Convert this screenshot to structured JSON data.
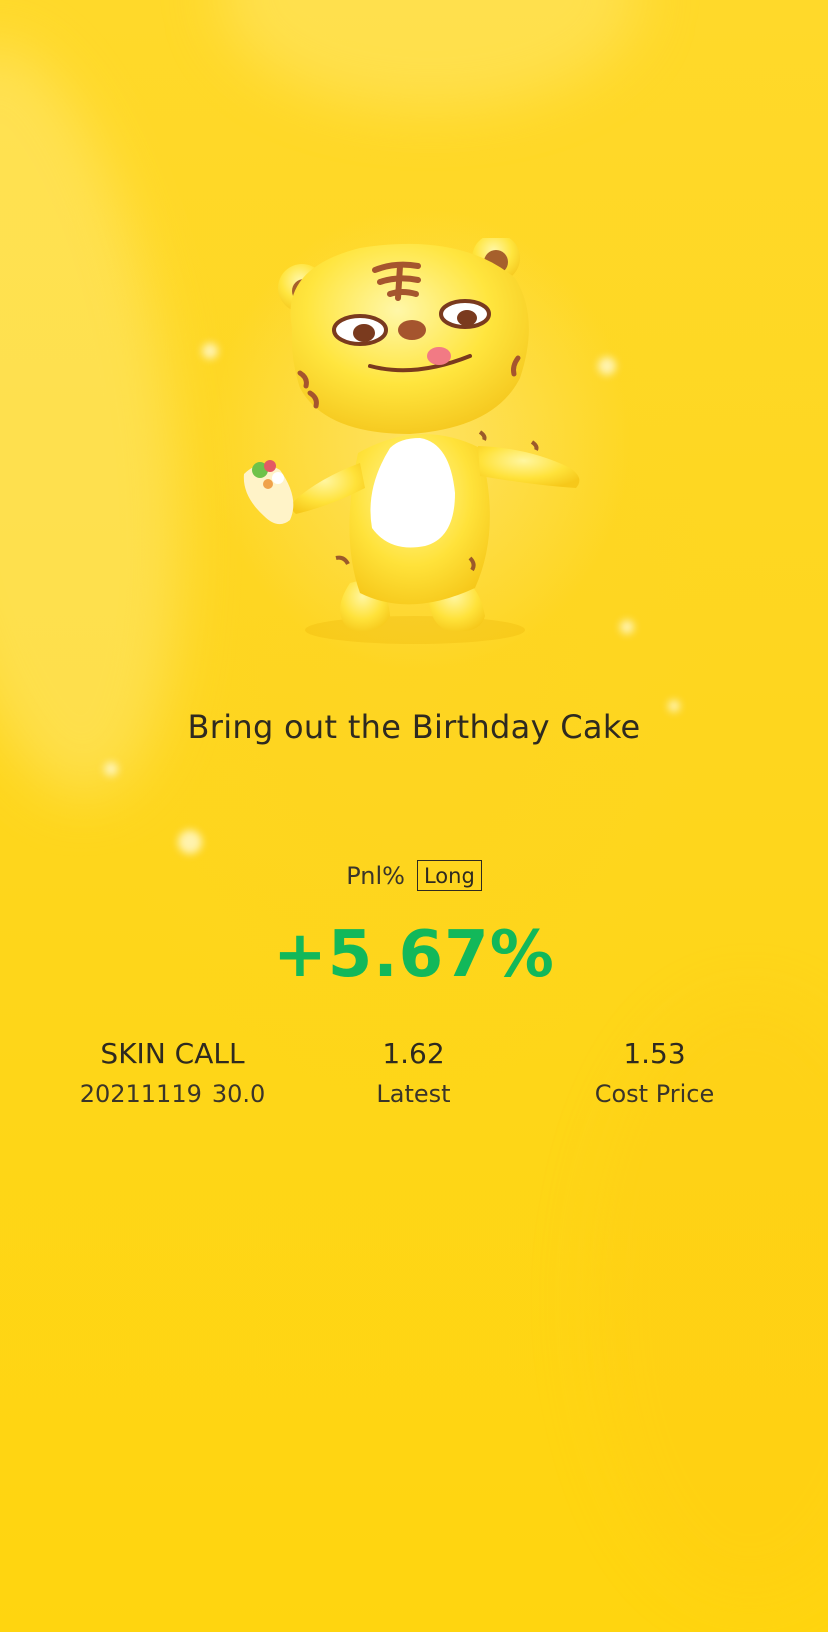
{
  "caption": "Bring out the Birthday Cake",
  "pnl": {
    "label": "Pnl%",
    "direction": "Long",
    "value": "+5.67%",
    "color": "#12b85a"
  },
  "stats": {
    "instrument": {
      "name": "SKIN CALL",
      "expiry": "20211119",
      "strike": "30.0"
    },
    "latest": {
      "value": "1.62",
      "label": "Latest"
    },
    "cost": {
      "value": "1.53",
      "label": "Cost Price"
    }
  },
  "theme": {
    "background": "#ffd92a",
    "text": "#2e2a20"
  },
  "mascot": {
    "icon": "tiger-mascot-illustration"
  }
}
